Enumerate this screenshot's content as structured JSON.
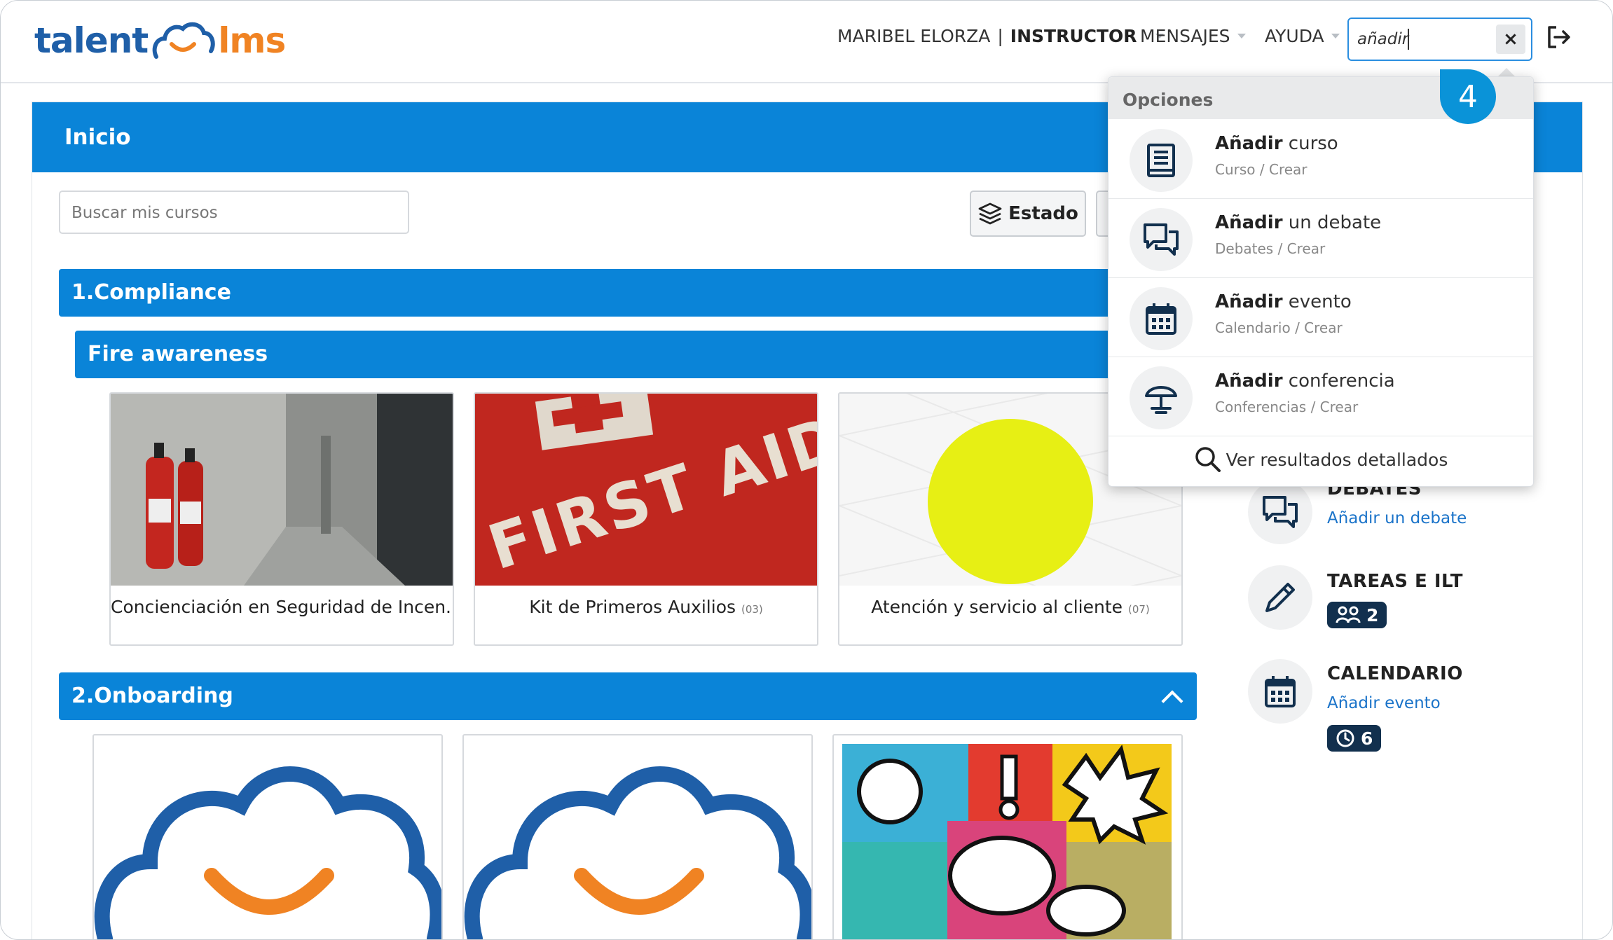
{
  "header": {
    "logo_talent": "talent",
    "logo_lms": "lms",
    "user_name": "MARIBEL ELORZA",
    "separator": "|",
    "role": "INSTRUCTOR",
    "nav_messages": "MENSAJES",
    "nav_help": "AYUDA",
    "search_value": "añadir",
    "clear_label": "×"
  },
  "main": {
    "title": "Inicio",
    "search_placeholder": "Buscar mis cursos",
    "estado_label": "Estado",
    "categories": [
      {
        "label": "1.Compliance",
        "subcategory": "Fire awareness",
        "courses": [
          {
            "title": "Concienciación en Seguridad de Incen...",
            "count": ""
          },
          {
            "title": "Kit de Primeros Auxilios",
            "count": "(03)"
          },
          {
            "title": "Atención y servicio al cliente",
            "count": "(07)"
          }
        ]
      },
      {
        "label": "2.Onboarding"
      }
    ],
    "first_aid_text": "FIRST AID"
  },
  "sidebar": {
    "debates_heading": "DEBATES",
    "debates_link": "Añadir un debate",
    "tasks_heading": "TAREAS E ILT",
    "tasks_count": "2",
    "calendar_heading": "CALENDARIO",
    "calendar_link": "Añadir evento",
    "calendar_count": "6"
  },
  "dropdown": {
    "heading": "Opciones",
    "items": [
      {
        "bold": "Añadir",
        "rest": " curso",
        "path": "Curso / Crear",
        "icon": "book-icon"
      },
      {
        "bold": "Añadir",
        "rest": " un debate",
        "path": "Debates / Crear",
        "icon": "discussion-icon"
      },
      {
        "bold": "Añadir",
        "rest": " evento",
        "path": "Calendario / Crear",
        "icon": "calendar-icon"
      },
      {
        "bold": "Añadir",
        "rest": " conferencia",
        "path": "Conferencias / Crear",
        "icon": "conference-icon"
      }
    ],
    "footer": "Ver resultados detallados"
  },
  "callout": {
    "step": "4"
  },
  "colors": {
    "primary": "#0a84d8",
    "brand_blue": "#1f5fa8",
    "brand_orange": "#f08323",
    "pill": "#12304e"
  }
}
